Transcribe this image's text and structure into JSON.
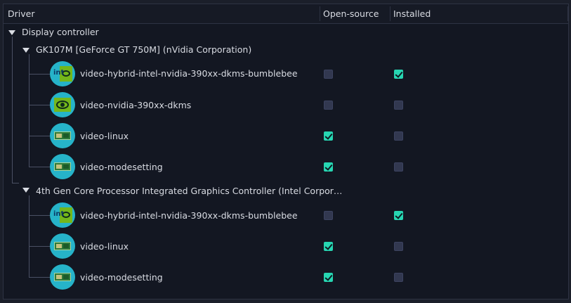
{
  "header": {
    "driver": "Driver",
    "open_source": "Open-source",
    "installed": "Installed"
  },
  "tree": {
    "category": "Display controller",
    "devices": [
      {
        "name": "GK107M [GeForce GT 750M] (nVidia Corporation)",
        "drivers": [
          {
            "name": "video-hybrid-intel-nvidia-390xx-dkms-bumblebee",
            "icon": "intel-nvidia-hybrid-icon",
            "open_source": false,
            "installed": true
          },
          {
            "name": "video-nvidia-390xx-dkms",
            "icon": "nvidia-icon",
            "open_source": false,
            "installed": false
          },
          {
            "name": "video-linux",
            "icon": "graphics-card-icon",
            "open_source": true,
            "installed": false
          },
          {
            "name": "video-modesetting",
            "icon": "graphics-card-icon",
            "open_source": true,
            "installed": false
          }
        ]
      },
      {
        "name": "4th Gen Core Processor Integrated Graphics Controller (Intel Corpor…",
        "drivers": [
          {
            "name": "video-hybrid-intel-nvidia-390xx-dkms-bumblebee",
            "icon": "intel-nvidia-hybrid-icon",
            "open_source": false,
            "installed": true
          },
          {
            "name": "video-linux",
            "icon": "graphics-card-icon",
            "open_source": true,
            "installed": false
          },
          {
            "name": "video-modesetting",
            "icon": "graphics-card-icon",
            "open_source": true,
            "installed": false
          }
        ]
      }
    ]
  },
  "colors": {
    "checked": "#27d6b2",
    "unchecked": "#323850",
    "icon_bg": "#26b3c9"
  }
}
